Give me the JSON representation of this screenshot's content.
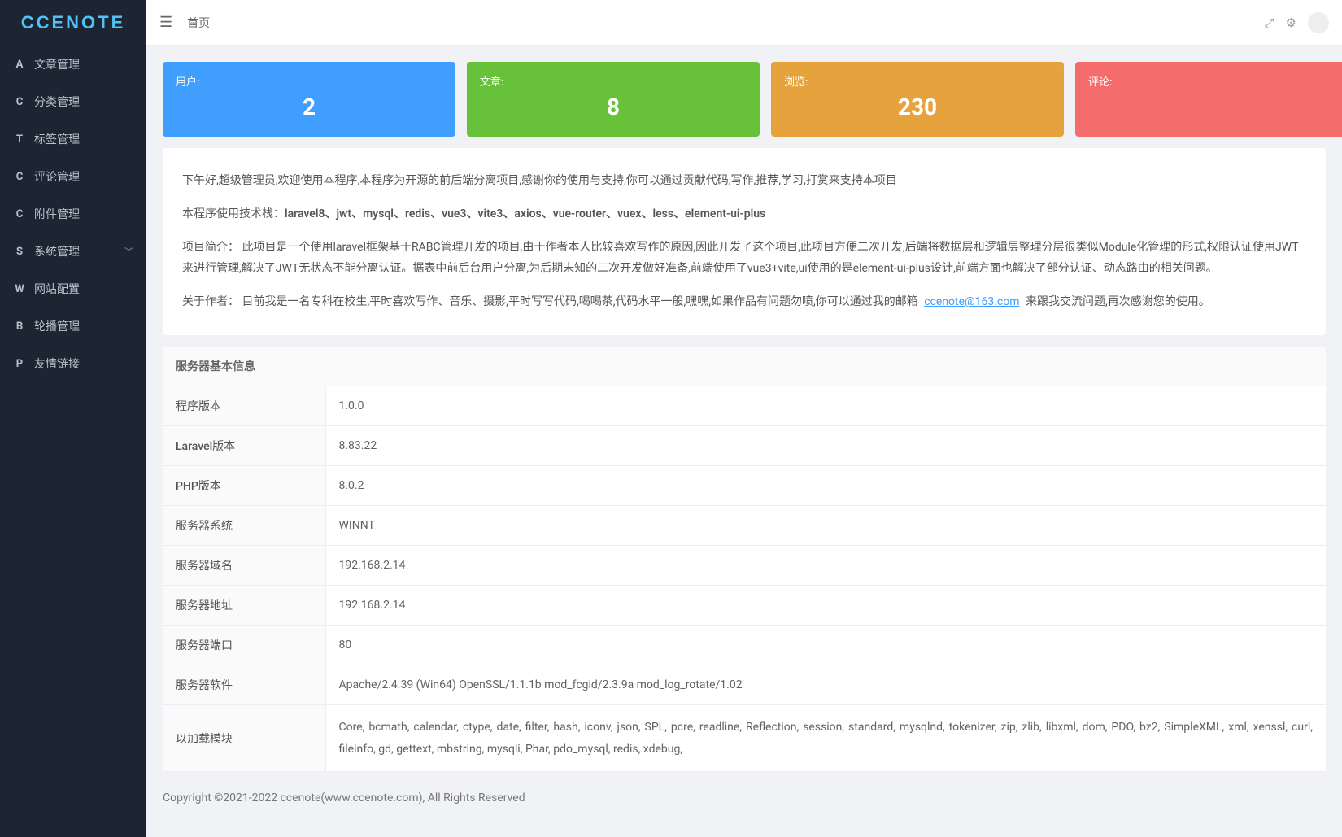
{
  "logo": "CCENOTE",
  "breadcrumb": "首页",
  "sidebar": {
    "items": [
      {
        "icon": "A",
        "label": "文章管理"
      },
      {
        "icon": "C",
        "label": "分类管理"
      },
      {
        "icon": "T",
        "label": "标签管理"
      },
      {
        "icon": "C",
        "label": "评论管理"
      },
      {
        "icon": "C",
        "label": "附件管理"
      },
      {
        "icon": "S",
        "label": "系统管理",
        "expandable": true
      },
      {
        "icon": "W",
        "label": "网站配置"
      },
      {
        "icon": "B",
        "label": "轮播管理"
      },
      {
        "icon": "P",
        "label": "友情链接"
      }
    ]
  },
  "stats": [
    {
      "label": "用户:",
      "value": "2",
      "color": "blue"
    },
    {
      "label": "文章:",
      "value": "8",
      "color": "green"
    },
    {
      "label": "浏览:",
      "value": "230",
      "color": "orange"
    },
    {
      "label": "评论:",
      "value": "",
      "color": "red"
    }
  ],
  "intro": {
    "greeting": "下午好,超级管理员,欢迎使用本程序,本程序为开源的前后端分离项目,感谢你的使用与支持,你可以通过贡献代码,写作,推荐,学习,打赏来支持本项目",
    "tech_prefix": "本程序使用技术栈：",
    "tech_stack": "laravel8、jwt、mysql、redis、vue3、vite3、axios、vue-router、vuex、less、element-ui-plus",
    "project_brief": "项目简介： 此项目是一个使用laravel框架基于RABC管理开发的项目,由于作者本人比较喜欢写作的原因,因此开发了这个项目,此项目方便二次开发,后端将数据层和逻辑层整理分层很类似Module化管理的形式,权限认证使用JWT来进行管理,解决了JWT无状态不能分离认证。据表中前后台用户分离,为后期未知的二次开发做好准备,前端使用了vue3+vite,ui使用的是element-ui-plus设计,前端方面也解决了部分认证、动态路由的相关问题。",
    "about_prefix": "关于作者： 目前我是一名专科在校生,平时喜欢写作、音乐、摄影,平时写写代码,喝喝茶,代码水平一般,嘿嘿,如果作品有问题勿喷,你可以通过我的邮箱 ",
    "email": "ccenote@163.com",
    "about_suffix": " 来跟我交流问题,再次感谢您的使用。"
  },
  "server": {
    "header": "服务器基本信息",
    "rows": [
      {
        "label": "程序版本",
        "value": "1.0.0"
      },
      {
        "label": "Laravel版本",
        "value": "8.83.22"
      },
      {
        "label": "PHP版本",
        "value": "8.0.2"
      },
      {
        "label": "服务器系统",
        "value": "WINNT"
      },
      {
        "label": "服务器域名",
        "value": "192.168.2.14"
      },
      {
        "label": "服务器地址",
        "value": "192.168.2.14"
      },
      {
        "label": "服务器端口",
        "value": "80"
      },
      {
        "label": "服务器软件",
        "value": "Apache/2.4.39  (Win64)  OpenSSL/1.1.1b  mod_fcgid/2.3.9a  mod_log_rotate/1.02"
      },
      {
        "label": "以加载模块",
        "value": "Core,  bcmath,  calendar,  ctype,  date,  filter,  hash,  iconv,  json,  SPL,  pcre,  readline,  Reflection,  session,  standard,  mysqlnd,  tokenizer,  zip,  zlib,  libxml,  dom,  PDO,  bz2,  SimpleXML,  xml,  xenssl,  curl,  fileinfo,  gd,  gettext,  mbstring,  mysqli,  Phar,  pdo_mysql,  redis,  xdebug,"
      }
    ]
  },
  "footer": "Copyright  ©2021-2022  ccenote(www.ccenote.com),  All  Rights  Reserved"
}
